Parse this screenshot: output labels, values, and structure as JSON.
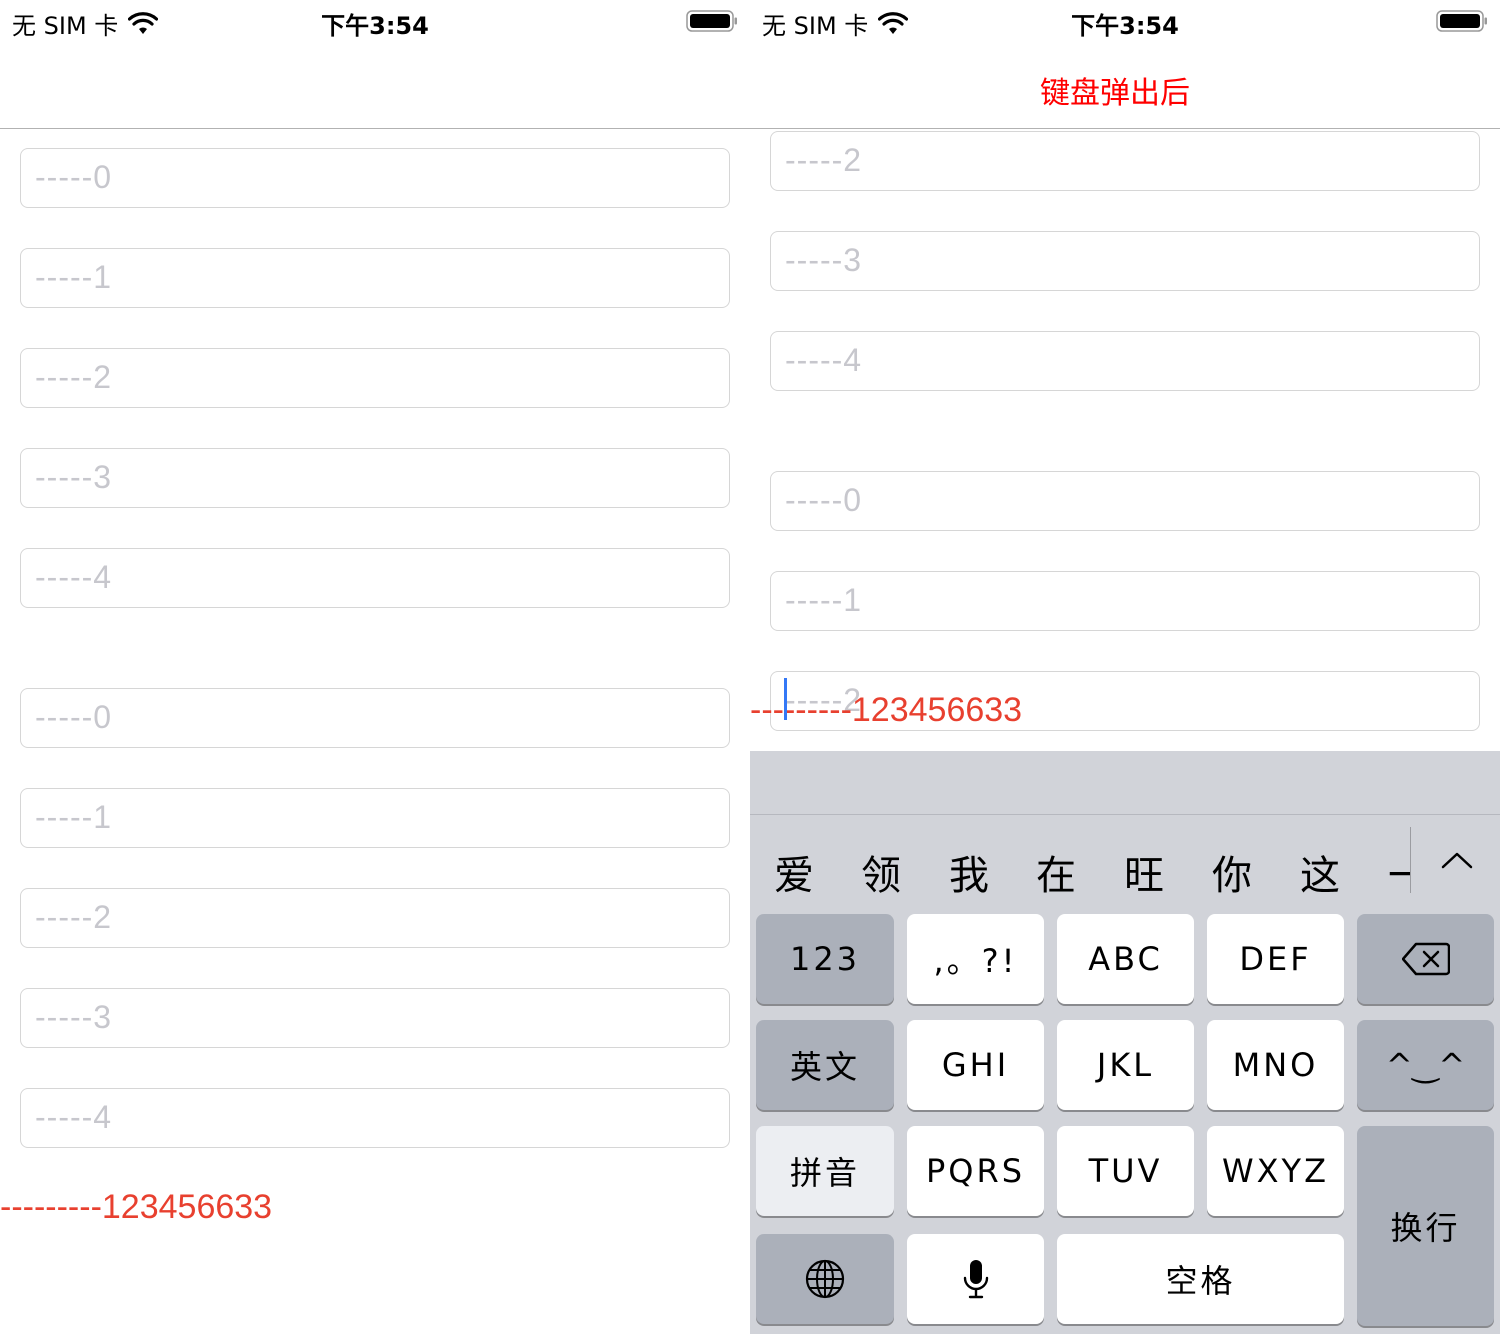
{
  "status_bar": {
    "carrier": "无 SIM 卡",
    "time": "下午3:54"
  },
  "left_screen": {
    "fields": [
      {
        "placeholder": "-----0"
      },
      {
        "placeholder": "-----1"
      },
      {
        "placeholder": "-----2"
      },
      {
        "placeholder": "-----3"
      },
      {
        "placeholder": "-----4"
      },
      {
        "placeholder": "-----0"
      },
      {
        "placeholder": "-----1"
      },
      {
        "placeholder": "-----2"
      },
      {
        "placeholder": "-----3"
      },
      {
        "placeholder": "-----4"
      }
    ],
    "footer_text": "---------123456633"
  },
  "right_screen": {
    "nav_title": "键盘弹出后",
    "fields": [
      {
        "placeholder": "-----2"
      },
      {
        "placeholder": "-----3"
      },
      {
        "placeholder": "-----4"
      },
      {
        "placeholder": "-----0"
      },
      {
        "placeholder": "-----1"
      },
      {
        "placeholder": "-----2"
      }
    ],
    "footer_text": "---------123456633"
  },
  "keyboard": {
    "candidates": [
      "爱",
      "领",
      "我",
      "在",
      "旺",
      "你",
      "这",
      "一"
    ],
    "keys": {
      "num": "123",
      "punct": ",。?!",
      "abc": "ABC",
      "def": "DEF",
      "english": "英文",
      "ghi": "GHI",
      "jkl": "JKL",
      "mno": "MNO",
      "emoticon": "^‿^",
      "pinyin": "拼音",
      "pqrs": "PQRS",
      "tuv": "TUV",
      "wxyz": "WXYZ",
      "return": "换行",
      "space": "空格"
    },
    "icons": {
      "delete": "delete-icon",
      "globe": "globe-icon",
      "mic": "microphone-icon",
      "expand": "chevron-up-icon"
    }
  },
  "colors": {
    "accent_red": "#ff0000",
    "footer_red": "#e8402f",
    "placeholder": "#c7c7cd",
    "caret": "#3478f6",
    "keyboard_bg": "#d1d3d9"
  }
}
